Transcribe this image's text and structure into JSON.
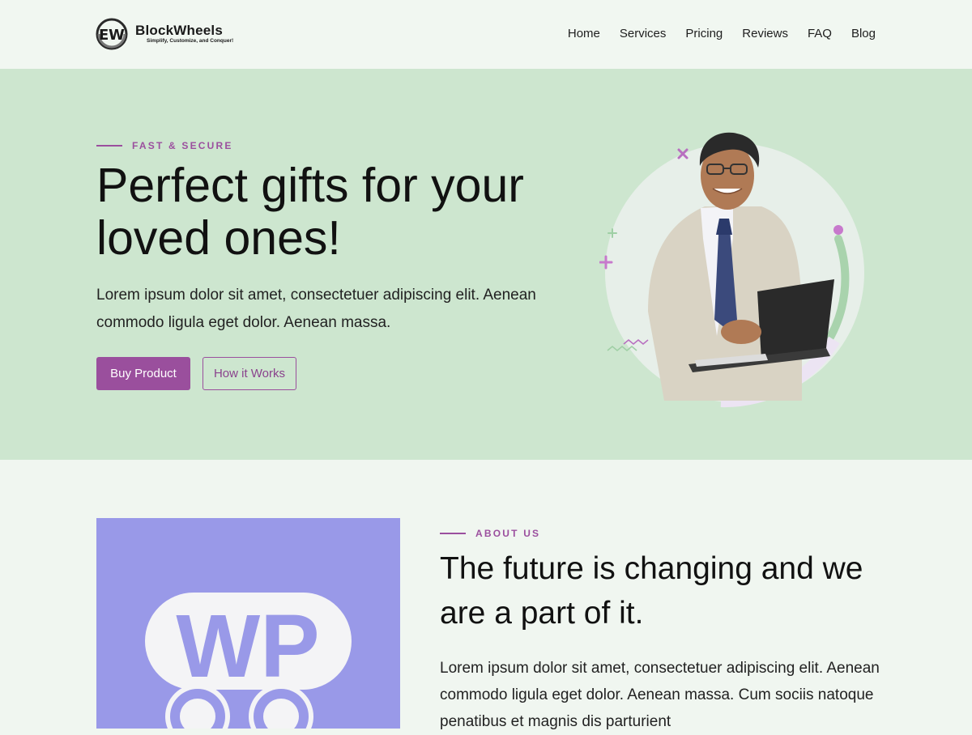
{
  "brand": {
    "name": "BlockWheels",
    "tagline": "Simplify, Customize, and Conquer!"
  },
  "nav": {
    "items": [
      "Home",
      "Services",
      "Pricing",
      "Reviews",
      "FAQ",
      "Blog"
    ]
  },
  "hero": {
    "eyebrow": "FAST & SECURE",
    "title": "Perfect gifts for your loved ones!",
    "text": "Lorem ipsum dolor sit amet, consectetuer adipiscing elit. Aenean commodo ligula eget dolor. Aenean massa.",
    "primary_button": "Buy Product",
    "secondary_button": "How it Works"
  },
  "about": {
    "eyebrow": "ABOUT US",
    "title": "The future is changing and we are a part of it.",
    "text": "Lorem ipsum dolor sit amet, consectetuer adipiscing elit. Aenean commodo ligula eget dolor. Aenean massa. Cum sociis natoque penatibus et magnis dis parturient",
    "image_text": "WP"
  },
  "colors": {
    "accent": "#9a4f9d",
    "hero_bg": "#cde6cf",
    "page_bg": "#f0f6f0",
    "about_image_bg": "#9999e8"
  }
}
